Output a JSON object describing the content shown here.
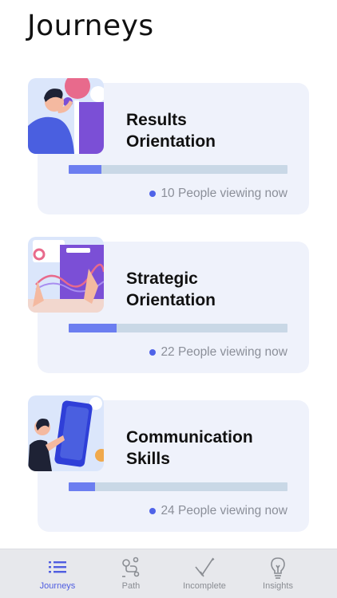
{
  "header": {
    "title": "Journeys"
  },
  "journeys": [
    {
      "title_line1": "Results",
      "title_line2": "Orientation",
      "progress": 0.15,
      "viewers": "10 People viewing now"
    },
    {
      "title_line1": "Strategic",
      "title_line2": "Orientation",
      "progress": 0.22,
      "viewers": "22 People viewing now"
    },
    {
      "title_line1": "Communication",
      "title_line2": "Skills",
      "progress": 0.12,
      "viewers": "24 People viewing now"
    }
  ],
  "tabbar": {
    "items": [
      {
        "label": "Journeys",
        "icon": "list-icon",
        "active": true
      },
      {
        "label": "Path",
        "icon": "path-icon",
        "active": false
      },
      {
        "label": "Incomplete",
        "icon": "check-pencil-icon",
        "active": false
      },
      {
        "label": "Insights",
        "icon": "lightbulb-icon",
        "active": false
      }
    ]
  },
  "colors": {
    "accent": "#4f5de0",
    "card_bg": "#eff2fb",
    "progress_fill": "#6c7ef0",
    "progress_track": "#c9d8e6"
  }
}
